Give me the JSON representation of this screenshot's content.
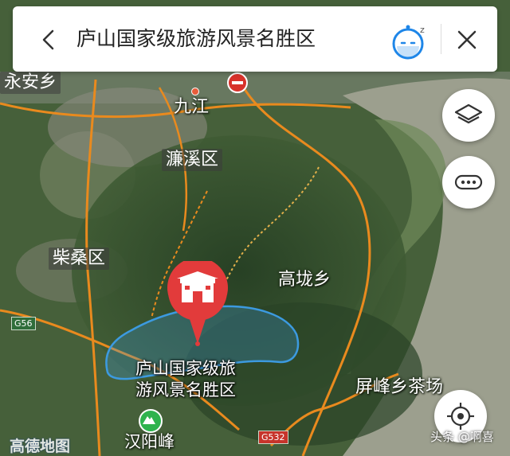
{
  "search": {
    "query": "庐山国家级旅游风景名胜区"
  },
  "places": {
    "yongan": "永安乡",
    "jiujiang": "九江",
    "lianxi": "濂溪区",
    "chaisang": "柴桑区",
    "gaolong": "高垅乡",
    "pingfeng": "屏峰乡茶场",
    "hanyangfeng": "汉阳峰"
  },
  "poi": {
    "name_line1": "庐山国家级旅",
    "name_line2": "游风景名胜区"
  },
  "road_signs": {
    "g56": "G56",
    "g532": "G532"
  },
  "logo": "高德地图",
  "watermark": "头条 @啊喜",
  "colors": {
    "marker": "#e23b3b",
    "boundary": "#3c9ae0",
    "road": "#e98a1e"
  },
  "icons": {
    "back": "chevron-left-icon",
    "assistant": "robot-assistant-icon",
    "close": "close-icon",
    "layers": "layers-icon",
    "more": "more-dots-icon",
    "locate": "locate-crosshair-icon",
    "poi": "scenic-gate-icon",
    "peak": "mountain-peak-icon"
  }
}
